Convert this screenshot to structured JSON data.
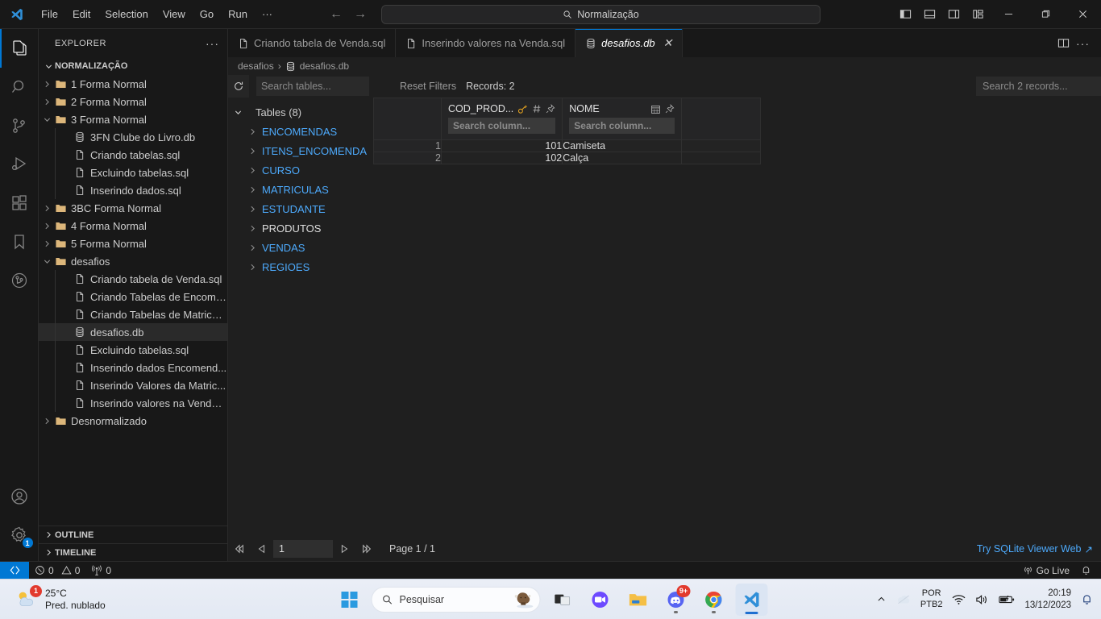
{
  "titlebar": {
    "menus": [
      "File",
      "Edit",
      "Selection",
      "View",
      "Go",
      "Run",
      "···"
    ],
    "command_center_text": "Normalização",
    "back_arrow": "←",
    "forward_arrow": "→"
  },
  "activitybar": {
    "items": [
      {
        "name": "explorer",
        "active": true
      },
      {
        "name": "search",
        "active": false
      },
      {
        "name": "source-control",
        "active": false
      },
      {
        "name": "run-and-debug",
        "active": false
      },
      {
        "name": "extensions",
        "active": false
      },
      {
        "name": "bookmarks",
        "active": false
      },
      {
        "name": "git-graph",
        "active": false
      }
    ],
    "settings_badge": "1"
  },
  "sidebar": {
    "title": "EXPLORER",
    "more_actions": "···",
    "root_label": "NORMALIZAÇÃO",
    "tree": [
      {
        "label": "1 Forma Normal",
        "kind": "folder",
        "depth": 1,
        "expanded": false
      },
      {
        "label": "2 Forma Normal",
        "kind": "folder",
        "depth": 1,
        "expanded": false
      },
      {
        "label": "3 Forma Normal",
        "kind": "folder",
        "depth": 1,
        "expanded": true
      },
      {
        "label": "3FN Clube do Livro.db",
        "kind": "db",
        "depth": 2
      },
      {
        "label": "Criando tabelas.sql",
        "kind": "file",
        "depth": 2
      },
      {
        "label": "Excluindo tabelas.sql",
        "kind": "file",
        "depth": 2
      },
      {
        "label": "Inserindo dados.sql",
        "kind": "file",
        "depth": 2
      },
      {
        "label": "3BC Forma Normal",
        "kind": "folder",
        "depth": 1,
        "expanded": false
      },
      {
        "label": "4 Forma Normal",
        "kind": "folder",
        "depth": 1,
        "expanded": false
      },
      {
        "label": "5 Forma Normal",
        "kind": "folder",
        "depth": 1,
        "expanded": false
      },
      {
        "label": "desafios",
        "kind": "folder",
        "depth": 1,
        "expanded": true
      },
      {
        "label": "Criando tabela de Venda.sql",
        "kind": "file",
        "depth": 2
      },
      {
        "label": "Criando Tabelas de Encome...",
        "kind": "file",
        "depth": 2
      },
      {
        "label": "Criando Tabelas de Matricul...",
        "kind": "file",
        "depth": 2
      },
      {
        "label": "desafios.db",
        "kind": "db",
        "depth": 2,
        "selected": true
      },
      {
        "label": "Excluindo tabelas.sql",
        "kind": "file",
        "depth": 2
      },
      {
        "label": "Inserindo dados Encomend...",
        "kind": "file",
        "depth": 2
      },
      {
        "label": "Inserindo Valores da Matric...",
        "kind": "file",
        "depth": 2
      },
      {
        "label": "Inserindo valores na Venda....",
        "kind": "file",
        "depth": 2
      },
      {
        "label": "Desnormalizado",
        "kind": "folder",
        "depth": 1,
        "expanded": false
      }
    ],
    "panels": [
      "OUTLINE",
      "TIMELINE"
    ]
  },
  "editor": {
    "tabs": [
      {
        "label": "Criando tabela de Venda.sql",
        "icon": "file-icon",
        "active": false,
        "closeable": false
      },
      {
        "label": "Inserindo valores na Venda.sql",
        "icon": "file-icon",
        "active": false,
        "closeable": false
      },
      {
        "label": "desafios.db",
        "icon": "database-icon",
        "active": true,
        "closeable": true
      }
    ],
    "tab_close_glyph": "✕",
    "breadcrumb": {
      "folder": "desafios",
      "separator": "›",
      "file": "desafios.db"
    }
  },
  "sqlite_viewer": {
    "refresh_icon": "refresh-icon",
    "search_tables_placeholder": "Search tables...",
    "reset_filters_label": "Reset Filters",
    "records_label": "Records: 2",
    "search_records_placeholder": "Search 2 records...",
    "tables_group_label": "Tables (8)",
    "tables": [
      {
        "name": "ENCOMENDAS",
        "selected": false
      },
      {
        "name": "ITENS_ENCOMENDA",
        "selected": false
      },
      {
        "name": "CURSO",
        "selected": false
      },
      {
        "name": "MATRICULAS",
        "selected": false
      },
      {
        "name": "ESTUDANTE",
        "selected": false
      },
      {
        "name": "PRODUTOS",
        "selected": true
      },
      {
        "name": "VENDAS",
        "selected": false
      },
      {
        "name": "REGIOES",
        "selected": false
      }
    ],
    "columns": [
      {
        "name": "COD_PROD...",
        "icons": [
          "key-icon",
          "hash-icon",
          "pin-icon"
        ],
        "search_placeholder": "Search column..."
      },
      {
        "name": "NOME",
        "icons": [
          "calendar-icon",
          "pin-icon"
        ],
        "search_placeholder": "Search column..."
      }
    ],
    "rows": [
      {
        "n": "1",
        "COD_PROD": "101",
        "NOME": "Camiseta"
      },
      {
        "n": "2",
        "COD_PROD": "102",
        "NOME": "Calça"
      }
    ],
    "pagination": {
      "first_glyph": "⏪",
      "prev_glyph": "◁",
      "next_glyph": "▷",
      "last_glyph": "⏩",
      "page_value": "1",
      "page_label": "Page 1 / 1"
    },
    "try_web_link": "Try SQLite Viewer Web",
    "try_web_arrow": "↗"
  },
  "statusbar": {
    "remote_icon": "remote-window-icon",
    "errors": "0",
    "warnings": "0",
    "ports": "0",
    "go_live": "Go Live",
    "bell_icon": "bell-icon"
  },
  "taskbar": {
    "weather_temp": "25°C",
    "weather_desc": "Pred. nublado",
    "weather_badge": "1",
    "search_placeholder": "Pesquisar",
    "discord_badge": "9+",
    "tray_lang_line1": "POR",
    "tray_lang_line2": "PTB2",
    "clock_time": "20:19",
    "clock_date": "13/12/2023",
    "apps": [
      "start-button",
      "search-box",
      "task-view",
      "teams-icon",
      "file-explorer-icon",
      "discord-icon",
      "chrome-icon",
      "vscode-icon"
    ]
  },
  "colors": {
    "accent": "#0078d4",
    "link": "#4daafc",
    "folder": "#dcb67a",
    "key": "#e0a020"
  }
}
